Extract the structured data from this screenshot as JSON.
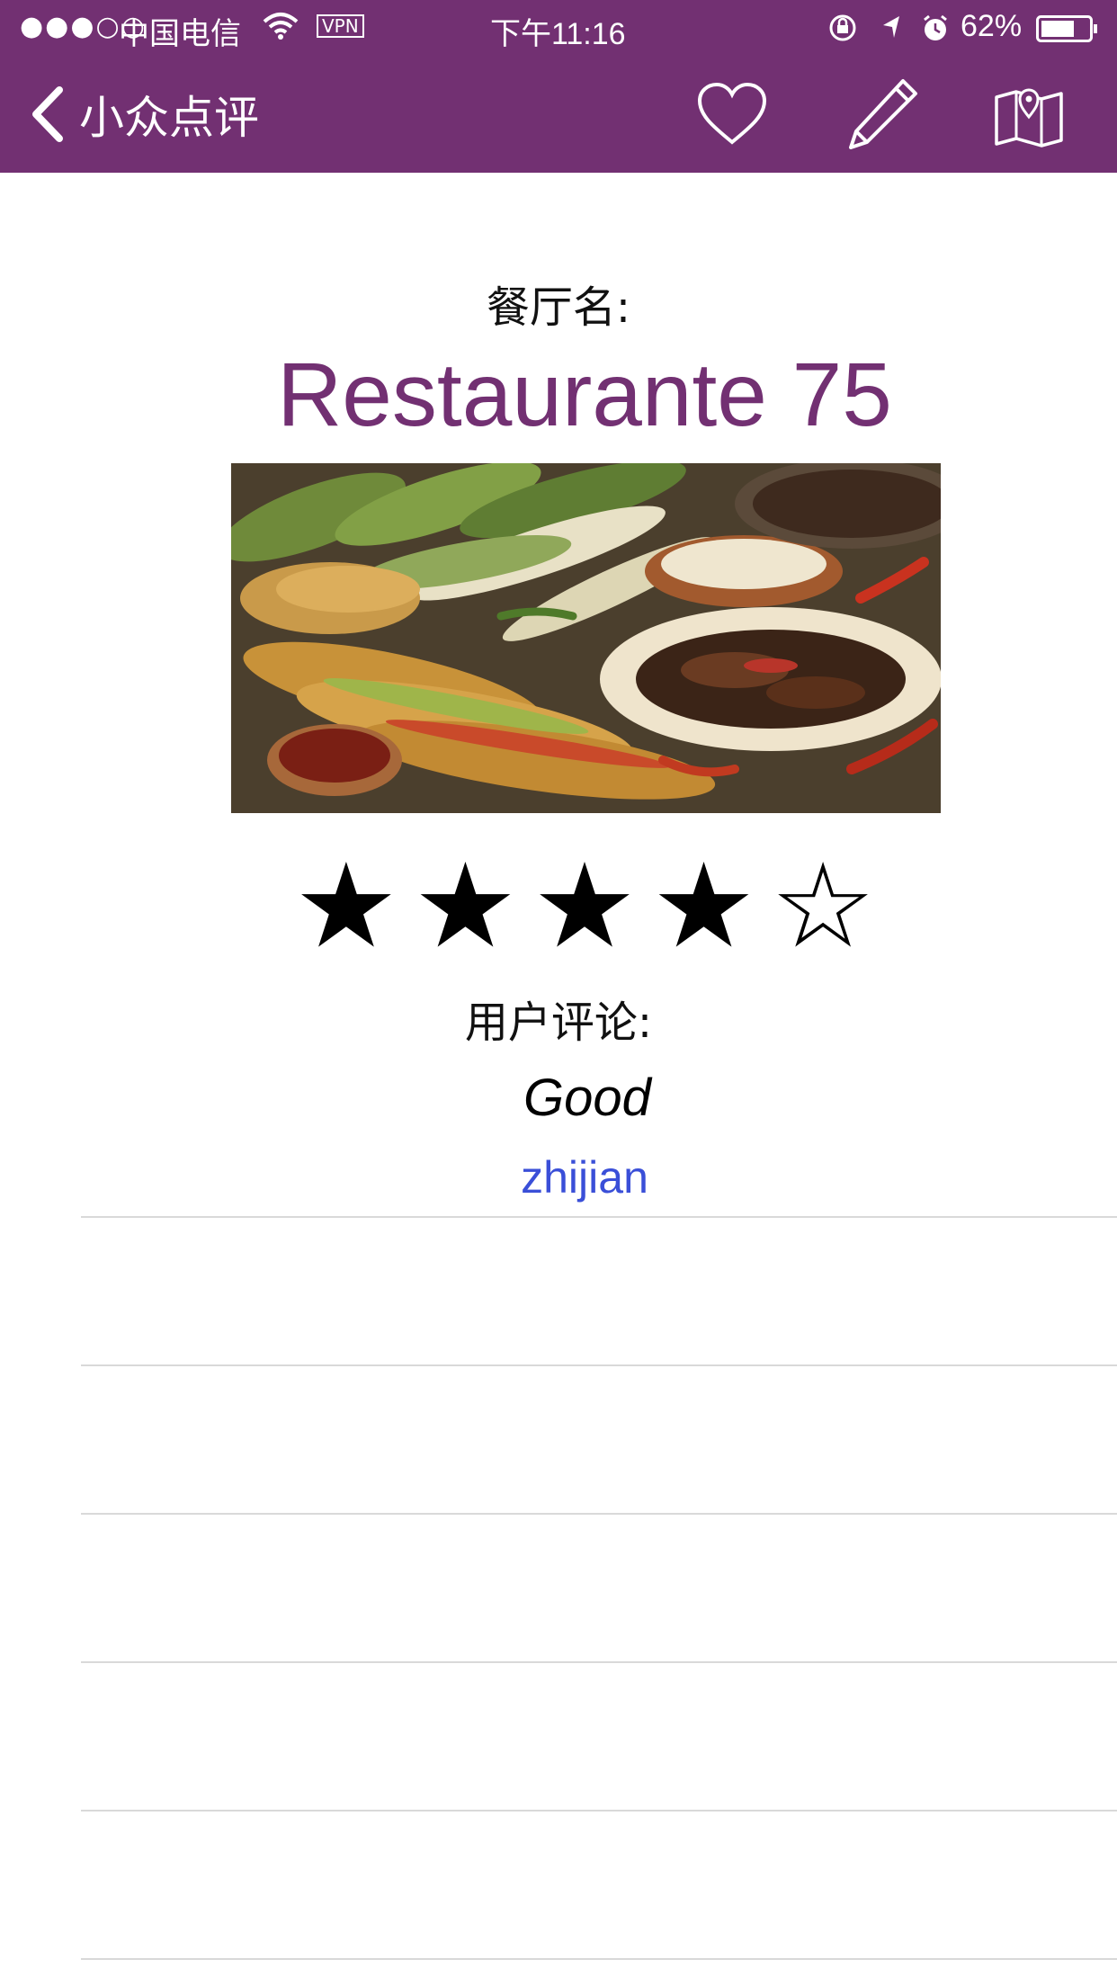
{
  "status_bar": {
    "signal": "●●●○○",
    "carrier": "中国电信",
    "vpn": "VPN",
    "time": "下午11:16",
    "battery_percent": "62%"
  },
  "nav": {
    "back_label": "小众点评",
    "icons": [
      "heart-icon",
      "pencil-icon",
      "map-icon"
    ]
  },
  "restaurant": {
    "name_label": "餐厅名:",
    "name": "Restaurante 75",
    "rating_stars_filled": 4,
    "rating_stars_total": 5
  },
  "review": {
    "label": "用户评论:",
    "text": "Good",
    "author": "zhijian"
  },
  "colors": {
    "brand": "#723072",
    "author_link": "#3a4fd8",
    "divider": "#d9d9d9"
  }
}
